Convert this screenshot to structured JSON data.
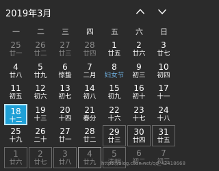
{
  "header": {
    "month_title": "2019年3月",
    "prev_icon": "chevron-up-icon",
    "next_icon": "chevron-down-icon"
  },
  "weekdays": [
    "一",
    "二",
    "三",
    "四",
    "五",
    "六",
    "日"
  ],
  "weeks": [
    [
      {
        "day": "25",
        "lunar": "廿一",
        "state": "other"
      },
      {
        "day": "26",
        "lunar": "廿二",
        "state": "other"
      },
      {
        "day": "27",
        "lunar": "廿三",
        "state": "other"
      },
      {
        "day": "28",
        "lunar": "廿四",
        "state": "other"
      },
      {
        "day": "1",
        "lunar": "廿五",
        "state": "current"
      },
      {
        "day": "2",
        "lunar": "廿六",
        "state": "current"
      },
      {
        "day": "3",
        "lunar": "廿七",
        "state": "current"
      }
    ],
    [
      {
        "day": "4",
        "lunar": "廿八",
        "state": "current"
      },
      {
        "day": "5",
        "lunar": "廿九",
        "state": "current"
      },
      {
        "day": "6",
        "lunar": "惊蛰",
        "state": "current"
      },
      {
        "day": "7",
        "lunar": "二月",
        "state": "current"
      },
      {
        "day": "8",
        "lunar": "妇女节",
        "state": "current",
        "festival": true
      },
      {
        "day": "9",
        "lunar": "初三",
        "state": "current"
      },
      {
        "day": "10",
        "lunar": "初四",
        "state": "current"
      }
    ],
    [
      {
        "day": "11",
        "lunar": "初五",
        "state": "current"
      },
      {
        "day": "12",
        "lunar": "初六",
        "state": "current"
      },
      {
        "day": "13",
        "lunar": "初七",
        "state": "current"
      },
      {
        "day": "14",
        "lunar": "初八",
        "state": "current"
      },
      {
        "day": "15",
        "lunar": "初九",
        "state": "current"
      },
      {
        "day": "16",
        "lunar": "初十",
        "state": "current"
      },
      {
        "day": "17",
        "lunar": "十一",
        "state": "current"
      }
    ],
    [
      {
        "day": "18",
        "lunar": "十二",
        "state": "today"
      },
      {
        "day": "19",
        "lunar": "十三",
        "state": "current"
      },
      {
        "day": "20",
        "lunar": "十四",
        "state": "current"
      },
      {
        "day": "21",
        "lunar": "春分",
        "state": "current"
      },
      {
        "day": "22",
        "lunar": "十六",
        "state": "current"
      },
      {
        "day": "23",
        "lunar": "十七",
        "state": "current"
      },
      {
        "day": "24",
        "lunar": "十八",
        "state": "current"
      }
    ],
    [
      {
        "day": "25",
        "lunar": "十九",
        "state": "current"
      },
      {
        "day": "26",
        "lunar": "二十",
        "state": "current"
      },
      {
        "day": "27",
        "lunar": "廿一",
        "state": "current"
      },
      {
        "day": "28",
        "lunar": "廿二",
        "state": "current"
      },
      {
        "day": "29",
        "lunar": "廿三",
        "state": "current",
        "framed": true
      },
      {
        "day": "30",
        "lunar": "廿四",
        "state": "current",
        "framed": true
      },
      {
        "day": "31",
        "lunar": "廿五",
        "state": "current",
        "framed": true
      }
    ],
    [
      {
        "day": "1",
        "lunar": "廿六",
        "state": "other",
        "framed": true
      },
      {
        "day": "2",
        "lunar": "廿七",
        "state": "other",
        "framed": true
      },
      {
        "day": "3",
        "lunar": "廿八",
        "state": "other",
        "framed": true
      },
      {
        "day": "4",
        "lunar": "廿九",
        "state": "other",
        "framed": true,
        "highlight": true
      },
      {
        "day": "5",
        "lunar": "清明",
        "state": "other",
        "framed": true
      },
      {
        "day": "6",
        "lunar": "初二",
        "state": "other"
      },
      {
        "day": "7",
        "lunar": "初三",
        "state": "other"
      }
    ]
  ],
  "watermark": "https://blog.csdn.net/qq_42418668"
}
